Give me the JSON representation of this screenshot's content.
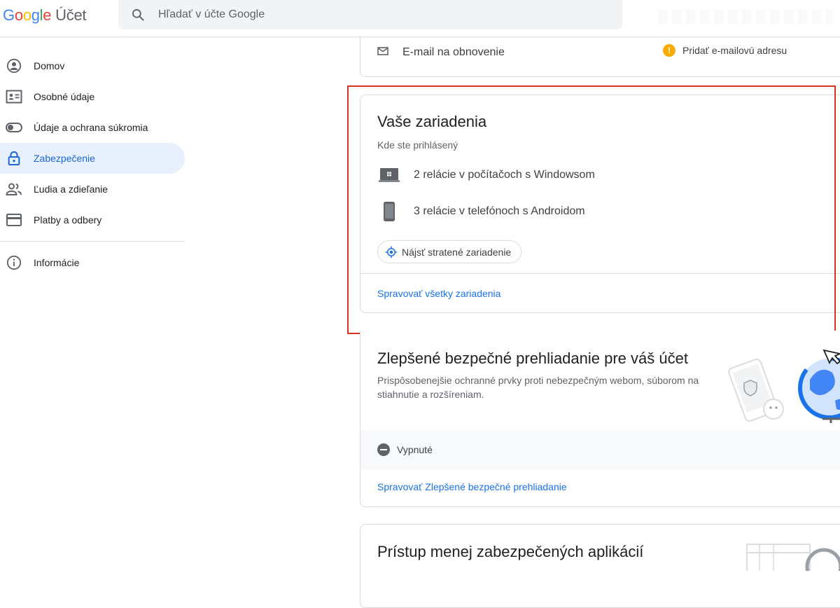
{
  "header": {
    "logo_letters": [
      "G",
      "o",
      "o",
      "g",
      "l",
      "e"
    ],
    "product": "Účet",
    "search_placeholder": "Hľadať v účte Google"
  },
  "sidebar": {
    "items": [
      {
        "label": "Domov",
        "icon": "account-circle-icon"
      },
      {
        "label": "Osobné údaje",
        "icon": "id-card-icon"
      },
      {
        "label": "Údaje a ochrana súkromia",
        "icon": "toggle-icon"
      },
      {
        "label": "Zabezpečenie",
        "icon": "lock-icon",
        "active": true
      },
      {
        "label": "Ľudia a zdieľanie",
        "icon": "people-icon"
      },
      {
        "label": "Platby a odbery",
        "icon": "credit-card-icon"
      },
      {
        "label": "Informácie",
        "icon": "info-icon"
      }
    ]
  },
  "recovery": {
    "label": "E-mail na obnovenie",
    "action": "Pridať e-mailovú adresu",
    "warning_glyph": "!"
  },
  "devices": {
    "title": "Vaše zariadenia",
    "subtitle": "Kde ste prihlásený",
    "rows": [
      {
        "label": "2 relácie v počítačoch s Windowsom",
        "icon": "windows-laptop-icon"
      },
      {
        "label": "3 relácie v telefónoch s Androidom",
        "icon": "phone-icon"
      }
    ],
    "find_button": "Nájsť stratené zariadenie",
    "manage_link": "Spravovať všetky zariadenia"
  },
  "safe_browsing": {
    "title": "Zlepšené bezpečné prehliadanie pre váš účet",
    "description": "Prispôsobenejšie ochranné prvky proti nebezpečným webom, súborom na stiahnutie a rozšíreniam.",
    "status": "Vypnuté",
    "manage_link": "Spravovať Zlepšené bezpečné prehliadanie"
  },
  "less_secure": {
    "title": "Prístup menej zabezpečených aplikácií"
  },
  "colors": {
    "accent": "#1a73e8",
    "active_bg": "#e8f0fe",
    "highlight_border": "#d93025",
    "warning": "#f9ab00"
  }
}
